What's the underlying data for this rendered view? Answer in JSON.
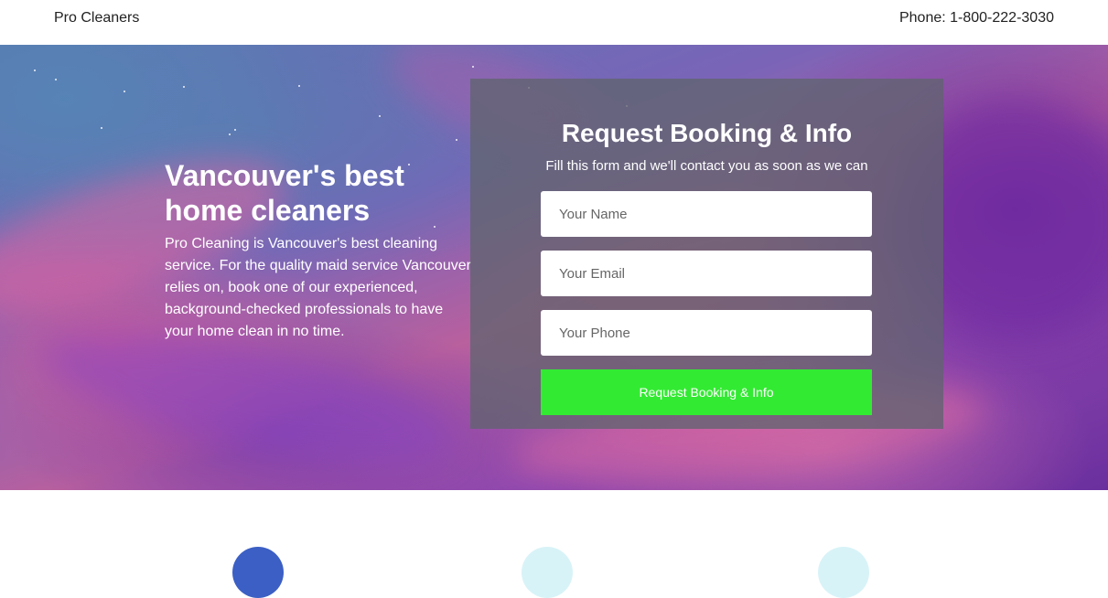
{
  "header": {
    "brand": "Pro Cleaners",
    "phone": "Phone: 1-800-222-3030"
  },
  "hero": {
    "heading": "Vancouver's best home cleaners",
    "description": "Pro Cleaning is Vancouver's best cleaning service. For the quality maid service Vancouver relies on, book one of our experienced, background-checked professionals to have your home clean in no time."
  },
  "form": {
    "title": "Request Booking & Info",
    "subtitle": "Fill this form and we'll contact you as soon as we can",
    "name_placeholder": "Your Name",
    "email_placeholder": "Your Email",
    "phone_placeholder": "Your Phone",
    "submit_label": "Request Booking & Info"
  },
  "colors": {
    "submit_button": "#33ea33",
    "form_panel": "#606470",
    "hero_blue": "#5a78b2",
    "hero_purple": "#6a2f9e",
    "hero_pink": "#d25a96"
  },
  "features": {
    "icons": [
      "feature-icon",
      "feature-icon",
      "feature-icon"
    ]
  }
}
